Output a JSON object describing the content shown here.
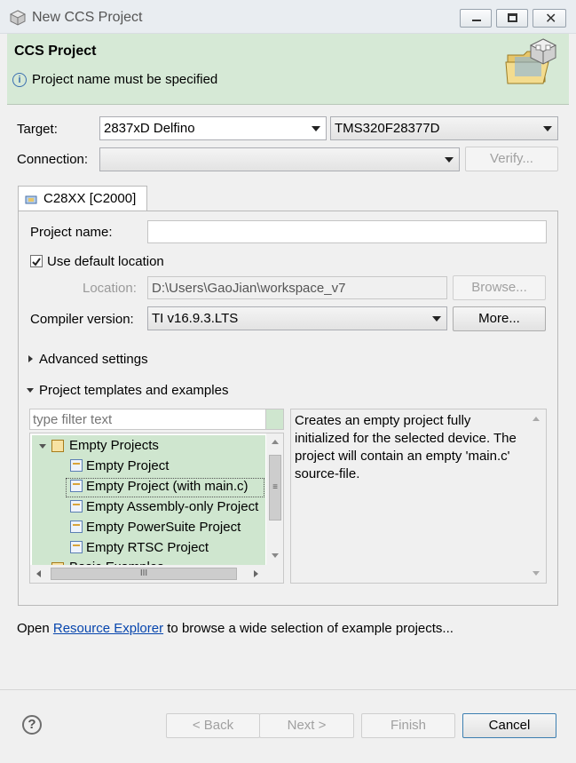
{
  "window": {
    "title": "New CCS Project"
  },
  "banner": {
    "title": "CCS Project",
    "message": "Project name must be specified"
  },
  "target": {
    "label": "Target:",
    "family": "2837xD Delfino",
    "device": "TMS320F28377D"
  },
  "connection": {
    "label": "Connection:",
    "value": "",
    "verify_label": "Verify..."
  },
  "tab": {
    "label": "C28XX [C2000]"
  },
  "project": {
    "name_label": "Project name:",
    "name_value": "",
    "use_default_label": "Use default location",
    "use_default_checked": true,
    "location_label": "Location:",
    "location_value": "D:\\Users\\GaoJian\\workspace_v7",
    "browse_label": "Browse...",
    "compiler_label": "Compiler version:",
    "compiler_value": "TI v16.9.3.LTS",
    "more_label": "More..."
  },
  "sections": {
    "advanced": "Advanced settings",
    "templates": "Project templates and examples"
  },
  "filter": {
    "placeholder": "type filter text"
  },
  "tree": {
    "group": "Empty Projects",
    "items": [
      "Empty Project",
      "Empty Project (with main.c)",
      "Empty Assembly-only Project",
      "Empty PowerSuite Project",
      "Empty RTSC Project"
    ],
    "next_group_partial": "Basic Examples",
    "hscroll_grip": "III",
    "vscroll_grip": "≡"
  },
  "description": "Creates an empty project fully initialized for the selected device. The project will contain an empty 'main.c' source-file.",
  "footer": {
    "text_before": "Open ",
    "link": "Resource Explorer",
    "text_after": " to browse a wide selection of example projects..."
  },
  "buttons": {
    "help": "?",
    "back": "< Back",
    "next": "Next >",
    "finish": "Finish",
    "cancel": "Cancel"
  },
  "colors": {
    "banner": "#d6e9d6",
    "selection": "#cfe6cf",
    "link": "#0645ad"
  }
}
